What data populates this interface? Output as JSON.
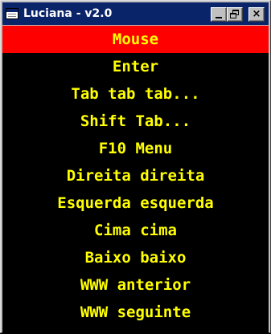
{
  "window": {
    "title": "Luciana - v2.0",
    "minimize_label": "",
    "maximize_label": "",
    "close_label": "×"
  },
  "menu": {
    "items": [
      {
        "label": "Mouse",
        "selected": true
      },
      {
        "label": "Enter",
        "selected": false
      },
      {
        "label": "Tab tab tab...",
        "selected": false
      },
      {
        "label": "Shift Tab...",
        "selected": false
      },
      {
        "label": "F10 Menu",
        "selected": false
      },
      {
        "label": "Direita direita",
        "selected": false
      },
      {
        "label": "Esquerda esquerda",
        "selected": false
      },
      {
        "label": "Cima cima",
        "selected": false
      },
      {
        "label": "Baixo baixo",
        "selected": false
      },
      {
        "label": "WWW anterior",
        "selected": false
      },
      {
        "label": "WWW seguinte",
        "selected": false
      }
    ]
  },
  "colors": {
    "title_bar": "#0a246a",
    "menu_background": "#000000",
    "menu_text": "#ffff00",
    "selected_background": "#ff0000"
  }
}
